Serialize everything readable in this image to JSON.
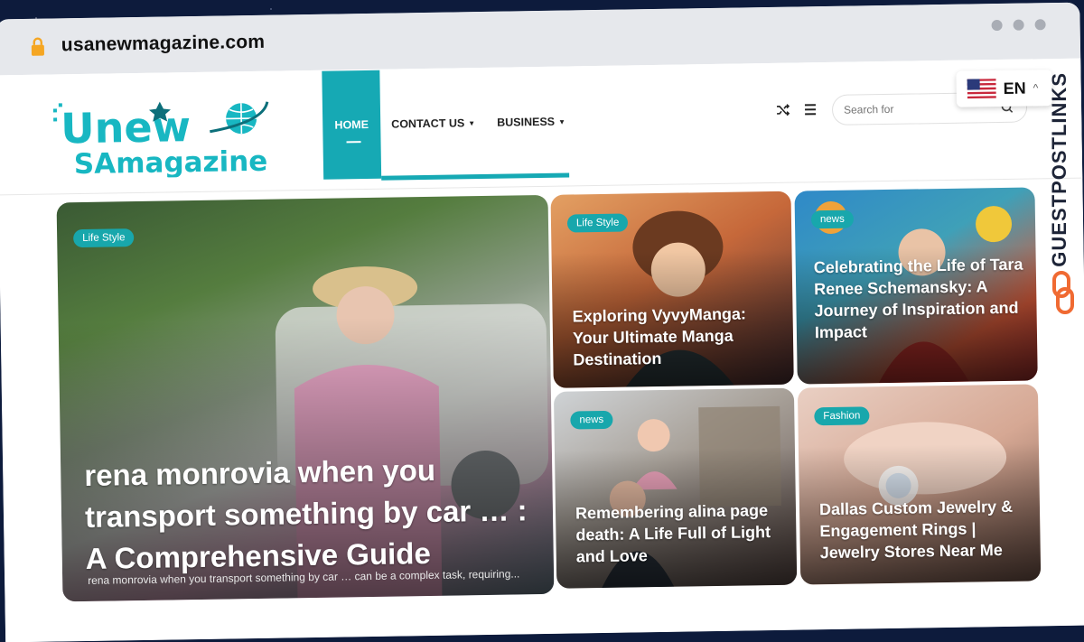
{
  "browser": {
    "url": "usanewmagazine.com"
  },
  "logo": {
    "line1": "Unew",
    "line2": "SAmagazine",
    "colors": {
      "teal": "#18b7c2",
      "dark": "#0c6f7a"
    }
  },
  "nav": {
    "items": [
      {
        "label": "HOME",
        "active": true
      },
      {
        "label": "CONTACT US",
        "dropdown": true
      },
      {
        "label": "BUSINESS",
        "dropdown": true
      }
    ],
    "accent": "#16a9b4"
  },
  "header_tools": {
    "shuffle_icon": "shuffle-icon",
    "menu_icon": "hamburger-menu-icon",
    "search_placeholder": "Search for"
  },
  "language": {
    "label": "EN",
    "flag": "us-flag-icon"
  },
  "side_brand": {
    "text": "GUESTPOSTLINKS",
    "icon": "chain-link-icon",
    "accent": "#f06a32"
  },
  "articles": [
    {
      "category": "Life Style",
      "title": "rena monrovia when you transport something by car … : A Comprehensive Guide",
      "excerpt": "rena monrovia when you transport something by car … can be a complex task, requiring..."
    },
    {
      "category": "Life Style",
      "title": "Exploring VyvyManga: Your Ultimate Manga Destination"
    },
    {
      "category": "news",
      "title": "Celebrating the Life of Tara Renee Schemansky: A Journey of Inspiration and Impact"
    },
    {
      "category": "news",
      "title": "Remembering alina page death: A Life Full of Light and Love"
    },
    {
      "category": "Fashion",
      "title": "Dallas Custom Jewelry & Engagement Rings | Jewelry Stores Near Me"
    }
  ]
}
